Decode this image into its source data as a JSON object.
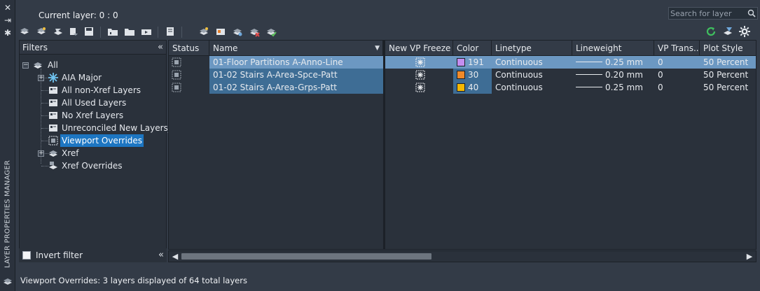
{
  "palette_title": "LAYER PROPERTIES MANAGER",
  "current_layer": "Current layer: 0 : 0",
  "search": {
    "placeholder": "Search for layer"
  },
  "toolbar": {
    "left_icons": [
      "new-property-filter-icon",
      "new-group-filter-icon",
      "layer-states-manager-icon",
      "layer-states-icon",
      "save-icon",
      "new-layer-icon",
      "new-folder-icon",
      "open-icon",
      "layer-translate-icon",
      "new-layer-vp-frozen-icon",
      "new-vp-layer-icon",
      "vp-override-icon",
      "delete-layer-icon",
      "set-current-icon"
    ],
    "right_icons": [
      "refresh-icon",
      "settings-icon",
      "gear-icon"
    ]
  },
  "filters": {
    "header": "Filters",
    "collapse_glyph": "«",
    "tree": [
      {
        "label": "All",
        "expander": "−",
        "icon": "all-layers-icon",
        "level": 0
      },
      {
        "label": "AIA Major",
        "expander": "+",
        "icon": "snowflake-icon",
        "level": 1
      },
      {
        "label": "All non-Xref Layers",
        "icon": "filter-icon",
        "level": 1
      },
      {
        "label": "All Used Layers",
        "icon": "filter-icon",
        "level": 1
      },
      {
        "label": "No Xref Layers",
        "icon": "filter-icon",
        "level": 1
      },
      {
        "label": "Unreconciled New Layers_",
        "icon": "filter-icon",
        "level": 1
      },
      {
        "label": "Viewport Overrides",
        "icon": "viewport-filter-icon",
        "level": 1,
        "selected": true
      },
      {
        "label": "Xref",
        "expander": "+",
        "icon": "xref-icon",
        "level": 1
      },
      {
        "label": "Xref Overrides",
        "icon": "xref-override-icon",
        "level": 1
      }
    ],
    "invert_label": "Invert filter",
    "invert_checked": false
  },
  "grid": {
    "columns": [
      "Status",
      "Name",
      "New VP Freeze",
      "Color",
      "Linetype",
      "Lineweight",
      "VP Trans...",
      "Plot Style"
    ],
    "rows": [
      {
        "status_icon": "viewport-layer-icon",
        "name": "01-Floor Partitions A-Anno-Line",
        "vp_icon": "vp-freeze-icon",
        "color_hex": "#c48ef0",
        "color_num": "191",
        "linetype": "Continuous",
        "lineweight": "0.25 mm",
        "vp_trans": "0",
        "plot_style": "50 Percent"
      },
      {
        "status_icon": "viewport-layer-icon",
        "name": "01-02 Stairs A-Area-Spce-Patt",
        "vp_icon": "vp-freeze-icon",
        "color_hex": "#f08a2a",
        "color_num": "30",
        "linetype": "Continuous",
        "lineweight": "0.20 mm",
        "vp_trans": "0",
        "plot_style": "50 Percent"
      },
      {
        "status_icon": "viewport-layer-icon",
        "name": "01-02 Stairs A-Area-Grps-Patt",
        "vp_icon": "vp-freeze-icon",
        "color_hex": "#f5b800",
        "color_num": "40",
        "linetype": "Continuous",
        "lineweight": "0.25 mm",
        "vp_trans": "0",
        "plot_style": "50 Percent"
      }
    ]
  },
  "status_bar": "Viewport Overrides: 3 layers displayed of 64 total layers"
}
